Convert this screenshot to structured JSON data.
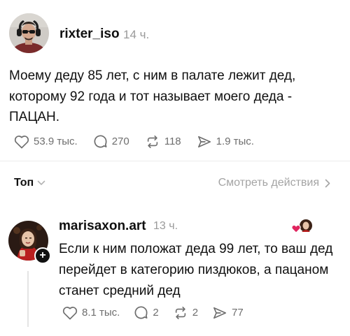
{
  "post": {
    "username": "rixter_iso",
    "time": "14 ч.",
    "text": "Моему деду 85 лет, с ним в палате лежит дед, которому 92 года и тот называет моего деда - ПАЦАН.",
    "stats": {
      "likes": "53.9 тыс.",
      "replies": "270",
      "reposts": "118",
      "shares": "1.9 тыс."
    }
  },
  "sort": {
    "label": "Топ",
    "view_activity": "Смотреть действия"
  },
  "reply": {
    "username": "marisaxon.art",
    "time": "13 ч.",
    "text": "Если к ним положат деда 99 лет, то ваш дед перейдет в категорию пиздюков, а пацаном станет средний дед",
    "stats": {
      "likes": "8.1 тыс.",
      "replies": "2",
      "reposts": "2",
      "shares": "77"
    }
  },
  "colors": {
    "text": "#101010",
    "muted": "#9a9a9a",
    "heart": "#e0245e"
  },
  "icons": [
    "heart-icon",
    "reply-icon",
    "repost-icon",
    "share-icon",
    "chevron-down-icon",
    "chevron-right-icon",
    "plus-icon"
  ]
}
